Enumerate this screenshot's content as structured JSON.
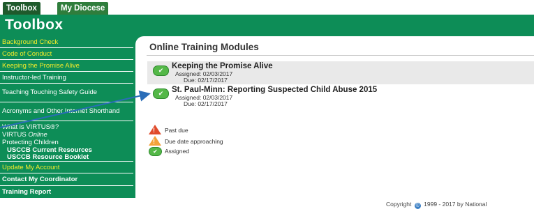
{
  "tabs": [
    {
      "label": "Toolbox"
    },
    {
      "label": "My Diocese"
    }
  ],
  "header": {
    "title": "Toolbox"
  },
  "sidebar": {
    "items": [
      {
        "label": "Background Check"
      },
      {
        "label": "Code of Conduct"
      },
      {
        "label": "Keeping the Promise Alive"
      },
      {
        "label": "Instructor-led Training"
      },
      {
        "label": "Teaching Touching Safety Guide"
      },
      {
        "label": "Acronyms and Other Internet Shorthand"
      },
      {
        "label": "What is VIRTUS®?"
      },
      {
        "label_main": "VIRTUS",
        "label_italic": "Online"
      },
      {
        "label": "Protecting Children"
      },
      {
        "label": "USCCB Current Resources"
      },
      {
        "label": "USCCB Resource Booklet"
      },
      {
        "label": "Update My Account"
      },
      {
        "label": "Contact My Coordinator"
      },
      {
        "label": "Training Report"
      }
    ]
  },
  "main": {
    "title": "Online Training Modules",
    "modules": [
      {
        "name": "Keeping the Promise Alive",
        "assigned": "Assigned: 02/03/2017",
        "due": "Due: 02/17/2017"
      },
      {
        "name": "St. Paul-Minn: Reporting Suspected Child Abuse 2015",
        "assigned": "Assigned: 02/03/2017",
        "due": "Due: 02/17/2017"
      }
    ],
    "legend": [
      {
        "label": "Past due",
        "icon": "warning-red-icon"
      },
      {
        "label": "Due date approaching",
        "icon": "warning-orange-icon"
      },
      {
        "label": "Assigned",
        "icon": "check-green-icon"
      }
    ]
  },
  "footer": {
    "copyright": "Copyright",
    "years": "1999 - 2017 by National"
  },
  "colors": {
    "brand_green": "#0d8d57",
    "highlight_yellow": "#f4ec2a",
    "check_green": "#54b848",
    "warning_red": "#e04b2b",
    "warning_orange": "#f3a33a",
    "arrow_blue": "#2a6db8"
  }
}
